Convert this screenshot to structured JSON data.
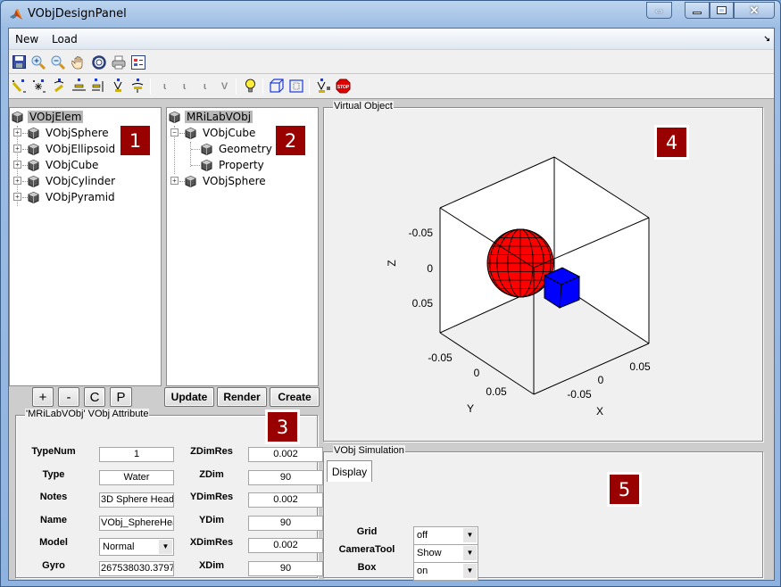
{
  "window": {
    "title": "VObjDesignPanel",
    "controls": {
      "swap": "⇔",
      "minimize": "—",
      "maximize": "☐",
      "close": "✕"
    }
  },
  "menu": {
    "items": [
      "New",
      "Load"
    ],
    "dock_icon": "↘"
  },
  "toolbar1": {
    "icons": [
      "save-icon",
      "zoom-in-icon",
      "zoom-out-icon",
      "pan-hand-icon",
      "rotate-3d-icon",
      "print-icon",
      "legend-icon"
    ]
  },
  "toolbar2": {
    "icons": [
      "camera-orbit-icon",
      "camera-orbit-scene-light-icon",
      "camera-pan-tilt-icon",
      "camera-move-horizontal-icon",
      "camera-move-forward-icon",
      "camera-zoom-icon",
      "camera-roll-icon",
      "principal-axis-x-icon",
      "principal-axis-y-icon",
      "principal-axis-z-icon",
      "principal-axis-none-icon",
      "scene-light-icon",
      "orthographic-projection-icon",
      "perspective-projection-icon",
      "reset-camera-icon",
      "stop-camera-icon"
    ]
  },
  "tree1": {
    "root": "VObjElem",
    "items": [
      "VObjSphere",
      "VObjEllipsoid",
      "VObjCube",
      "VObjCylinder",
      "VObjPyramid"
    ],
    "buttons": [
      "+",
      "-",
      "C",
      "P"
    ]
  },
  "tree2": {
    "root": "MRiLabVObj",
    "items": [
      {
        "label": "VObjCube",
        "expanded": true,
        "children": [
          "Geometry",
          "Property"
        ]
      },
      {
        "label": "VObjSphere",
        "expanded": false
      }
    ],
    "buttons": [
      "Update",
      "Render",
      "Create"
    ]
  },
  "attributes": {
    "title": "'MRiLabVObj' VObj Attribute",
    "left": [
      {
        "label": "TypeNum",
        "value": "1"
      },
      {
        "label": "Type",
        "value": "Water"
      },
      {
        "label": "Notes",
        "value": "3D Sphere Head"
      },
      {
        "label": "Name",
        "value": "VObj_SphereHea"
      },
      {
        "label": "Model",
        "value": "Normal",
        "type": "select"
      },
      {
        "label": "Gyro",
        "value": "267538030.3797"
      }
    ],
    "right": [
      {
        "label": "ZDimRes",
        "value": "0.002"
      },
      {
        "label": "ZDim",
        "value": "90"
      },
      {
        "label": "YDimRes",
        "value": "0.002"
      },
      {
        "label": "YDim",
        "value": "90"
      },
      {
        "label": "XDimRes",
        "value": "0.002"
      },
      {
        "label": "XDim",
        "value": "90"
      }
    ]
  },
  "virtual_object": {
    "title": "Virtual Object",
    "axes": {
      "zlabel": "Z",
      "ylabel": "Y",
      "xlabel": "X",
      "z_ticks": [
        "-0.05",
        "0",
        "0.05"
      ],
      "y_ticks": [
        "-0.05",
        "0",
        "0.05"
      ],
      "x_ticks": [
        "-0.05",
        "0",
        "0.05"
      ]
    },
    "objects": [
      {
        "name": "sphere",
        "color": "#ff0000"
      },
      {
        "name": "cube",
        "color": "#0000ff"
      }
    ]
  },
  "simulation": {
    "title": "VObj Simulation",
    "tab": "Display",
    "settings": [
      {
        "label": "Grid",
        "value": "off"
      },
      {
        "label": "CameraTool",
        "value": "Show"
      },
      {
        "label": "Box",
        "value": "on"
      }
    ]
  },
  "badges": [
    "1",
    "2",
    "3",
    "4",
    "5"
  ],
  "colors": {
    "badge": "#990000",
    "tree_root_highlight": "#b8b8b8",
    "sphere": "#ff0000",
    "cube": "#0000ff"
  }
}
